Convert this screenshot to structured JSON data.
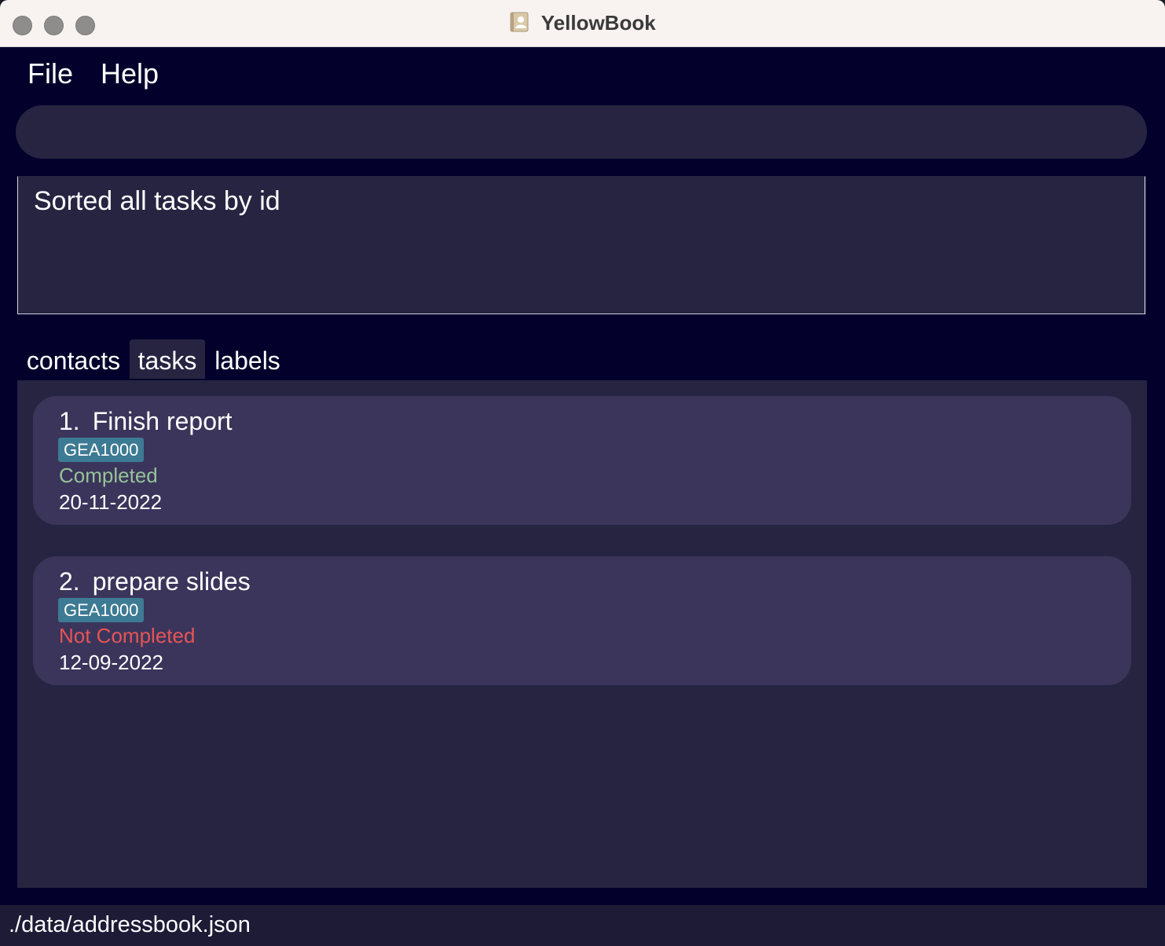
{
  "window": {
    "title": "YellowBook"
  },
  "menu": {
    "file": "File",
    "help": "Help"
  },
  "command": {
    "value": "",
    "placeholder": ""
  },
  "result": {
    "message": "Sorted all tasks by id"
  },
  "tabs": [
    {
      "label": "contacts",
      "selected": false
    },
    {
      "label": "tasks",
      "selected": true
    },
    {
      "label": "labels",
      "selected": false
    }
  ],
  "tasks": [
    {
      "index": "1.",
      "title": "Finish report",
      "label": "GEA1000",
      "status": "Completed",
      "date": "20-11-2022"
    },
    {
      "index": "2.",
      "title": "prepare slides",
      "label": "GEA1000",
      "status": "Not Completed",
      "date": "12-09-2022"
    }
  ],
  "status_bar": {
    "path": "./data/addressbook.json"
  },
  "colors": {
    "window_bg": "#03012b",
    "panel_bg": "#272442",
    "card_bg": "#3b355c",
    "tag_bg": "#3d7a94",
    "completed": "#96c396",
    "not_completed": "#e55555"
  }
}
